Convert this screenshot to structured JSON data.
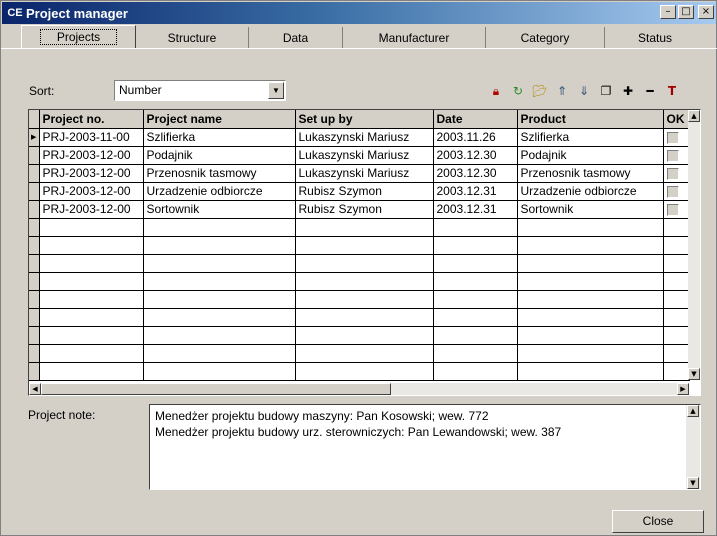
{
  "window": {
    "title": "Project manager",
    "icon": "CE",
    "controls": {
      "minimize": "–",
      "maximize": "□",
      "close": "×"
    }
  },
  "tabs": [
    "Projects",
    "Structure",
    "Data",
    "Manufacturer",
    "Category",
    "Status"
  ],
  "sort": {
    "label": "Sort:",
    "value": "Number"
  },
  "toolbar": [
    "lock-icon",
    "refresh-icon",
    "open-folder-icon",
    "move-up-icon",
    "move-down-icon",
    "copy-icon",
    "add-icon",
    "remove-icon",
    "text-icon"
  ],
  "grid": {
    "columns": [
      "Project no.",
      "Project name",
      "Set up by",
      "Date",
      "Product",
      "OK"
    ],
    "rows": [
      [
        "PRJ-2003-11-00",
        "Szlifierka",
        "Lukaszynski Mariusz",
        "2003.11.26",
        "Szlifierka",
        ""
      ],
      [
        "PRJ-2003-12-00",
        "Podajnik",
        "Lukaszynski Mariusz",
        "2003.12.30",
        "Podajnik",
        ""
      ],
      [
        "PRJ-2003-12-00",
        "Przenosnik tasmowy",
        "Lukaszynski Mariusz",
        "2003.12.30",
        "Przenosnik tasmowy",
        ""
      ],
      [
        "PRJ-2003-12-00",
        "Urzadzenie odbiorcze",
        "Rubisz Szymon",
        "2003.12.31",
        "Urzadzenie odbiorcze",
        ""
      ],
      [
        "PRJ-2003-12-00",
        "Sortownik",
        "Rubisz Szymon",
        "2003.12.31",
        "Sortownik",
        ""
      ]
    ],
    "selected_row_marker": "▶"
  },
  "note": {
    "label": "Project note:",
    "lines": [
      "Menedżer projektu budowy maszyny: Pan Kosowski; wew. 772",
      "Menedżer projektu budowy urz. sterowniczych: Pan Lewandowski; wew. 387"
    ]
  },
  "close_button": "Close"
}
